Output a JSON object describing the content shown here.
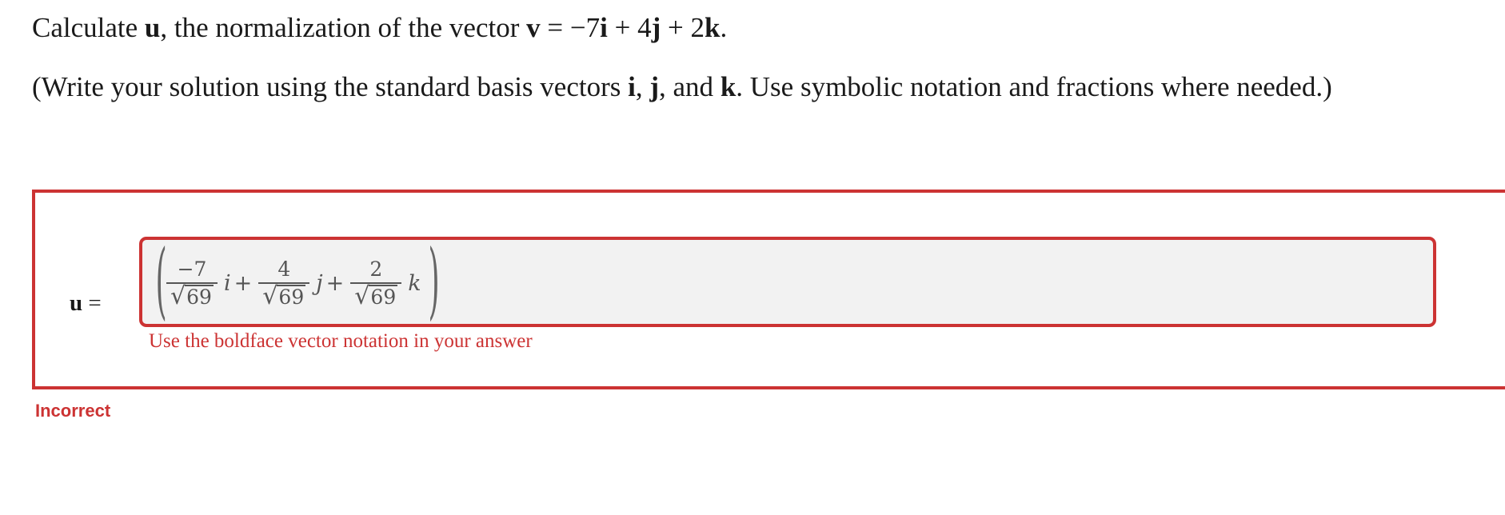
{
  "question": {
    "line1": {
      "prefix": "Calculate ",
      "u": "u",
      "middle": ", the normalization of the vector ",
      "v": "v",
      "eq": " = −7",
      "i": "i",
      "plus1": " + 4",
      "j": "j",
      "plus2": " + 2",
      "k": "k",
      "end": "."
    },
    "line2": {
      "prefix": "(Write your solution using the standard basis vectors ",
      "i": "i",
      "comma1": ", ",
      "j": "j",
      "and": ", and ",
      "k": "k",
      "suffix": ". Use symbolic notation and fractions where needed.)"
    }
  },
  "answer": {
    "label_var": "u",
    "label_eq": " =",
    "expression": {
      "open_paren": "(",
      "close_paren": ")",
      "terms": [
        {
          "numerator": "−7",
          "radicand": "69",
          "variable": "i",
          "operator": "+"
        },
        {
          "numerator": "4",
          "radicand": "69",
          "variable": "j",
          "operator": "+"
        },
        {
          "numerator": "2",
          "radicand": "69",
          "variable": "k",
          "operator": ""
        }
      ],
      "sqrt_symbol": "√"
    },
    "feedback": "Use the boldface vector notation in your answer",
    "status": "Incorrect"
  },
  "colors": {
    "error": "#cc3333",
    "input_bg": "#f2f2f2",
    "text": "#1a1a1a"
  }
}
